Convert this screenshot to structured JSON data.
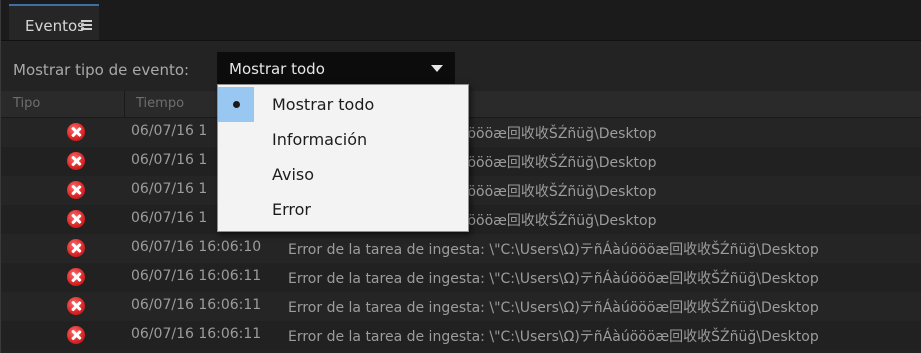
{
  "panel": {
    "tab_label": "Eventos",
    "menu_icon": "hamburger-menu-icon"
  },
  "filter": {
    "label": "Mostrar tipo de evento:",
    "selected": "Mostrar todo"
  },
  "table": {
    "columns": [
      "Tipo",
      "Tiempo"
    ],
    "rows": [
      {
        "type": "error",
        "time": "06/07/16 1",
        "desc": "esta: \\\"C:\\Users\\Ω)テñÁàúöööæ回收收ŠŹñüğ\\Desktop"
      },
      {
        "type": "error",
        "time": "06/07/16 1",
        "desc": "esta: \\\"C:\\Users\\Ω)テñÁàúöööæ回收收ŠŹñüğ\\Desktop"
      },
      {
        "type": "error",
        "time": "06/07/16 1",
        "desc": "esta: \\\"C:\\Users\\Ω)テñÁàúöööæ回收收ŠŹñüğ\\Desktop"
      },
      {
        "type": "error",
        "time": "06/07/16 1",
        "desc": "esta: \\\"C:\\Users\\Ω)テñÁàúöööæ回收收ŠŹñüğ\\Desktop"
      },
      {
        "type": "error",
        "time": "06/07/16 16:06:10",
        "desc": "Error de la tarea de ingesta: \\\"C:\\Users\\Ω)テñÁàúöööæ回收收ŠŹñüğ\\Desktop"
      },
      {
        "type": "error",
        "time": "06/07/16 16:06:11",
        "desc": "Error de la tarea de ingesta: \\\"C:\\Users\\Ω)テñÁàúöööæ回收收ŠŹñüğ\\Desktop"
      },
      {
        "type": "error",
        "time": "06/07/16 16:06:11",
        "desc": "Error de la tarea de ingesta: \\\"C:\\Users\\Ω)テñÁàúöööæ回收收ŠŹñüğ\\Desktop"
      },
      {
        "type": "error",
        "time": "06/07/16 16:06:11",
        "desc": "Error de la tarea de ingesta: \\\"C:\\Users\\Ω)テñÁàúöööæ回收收ŠŹñüğ\\Desktop"
      }
    ]
  },
  "dropdown": {
    "items": [
      {
        "label": "Mostrar todo",
        "checked": true
      },
      {
        "label": "Información",
        "checked": false
      },
      {
        "label": "Aviso",
        "checked": false
      },
      {
        "label": "Error",
        "checked": false
      }
    ]
  },
  "colors": {
    "panel_bg": "#232323",
    "menu_highlight": "#98c8f2",
    "error_red": "#d92424"
  }
}
